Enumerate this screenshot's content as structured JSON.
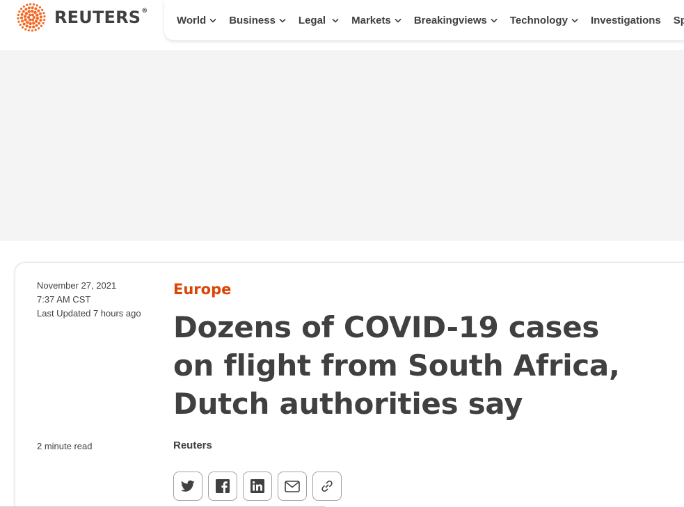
{
  "header": {
    "logo_text": "REUTERS",
    "logo_registered": "®",
    "logo_color": "#f26722"
  },
  "nav": {
    "items": [
      {
        "label": "World",
        "has_dropdown": true
      },
      {
        "label": "Business",
        "has_dropdown": true
      },
      {
        "label": "Legal",
        "has_dropdown": true
      },
      {
        "label": "Markets",
        "has_dropdown": true
      },
      {
        "label": "Breakingviews",
        "has_dropdown": true
      },
      {
        "label": "Technology",
        "has_dropdown": true
      },
      {
        "label": "Investigations",
        "has_dropdown": false
      },
      {
        "label": "Sports",
        "has_dropdown": false
      }
    ]
  },
  "article": {
    "date": "November 27, 2021",
    "time": "7:37 AM CST",
    "last_updated": "Last Updated 7 hours ago",
    "read_time": "2 minute read",
    "section": "Europe",
    "headline": "Dozens of COVID-19 cases on flight from South Africa, Dutch authorities say",
    "byline": "Reuters"
  },
  "share": {
    "buttons": [
      {
        "icon": "twitter-icon",
        "name": "share-twitter-button"
      },
      {
        "icon": "facebook-icon",
        "name": "share-facebook-button"
      },
      {
        "icon": "linkedin-icon",
        "name": "share-linkedin-button"
      },
      {
        "icon": "email-icon",
        "name": "share-email-button"
      },
      {
        "icon": "link-icon",
        "name": "share-link-button"
      }
    ]
  },
  "colors": {
    "accent": "#dc4405",
    "text": "#404040",
    "ad_background": "#f4f4f4"
  }
}
